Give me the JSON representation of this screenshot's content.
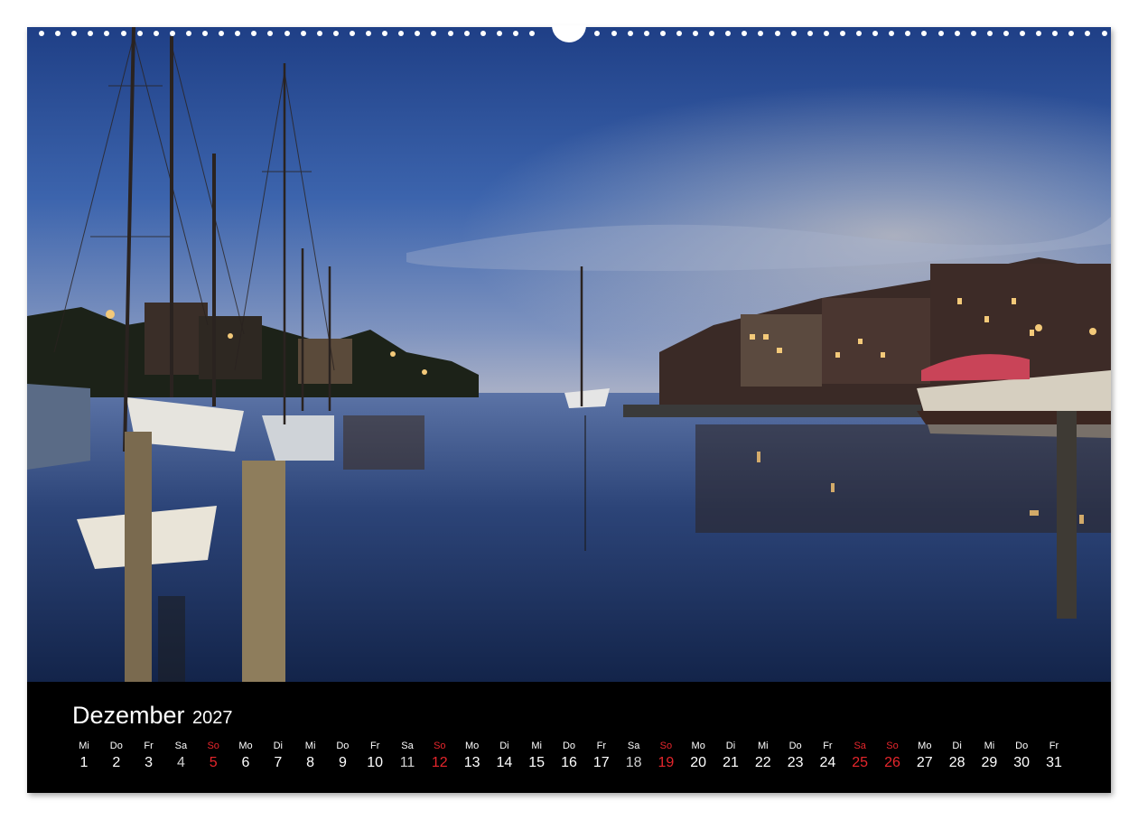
{
  "calendar": {
    "month": "Dezember",
    "year": "2027",
    "colors": {
      "weekday": "#ffffff",
      "sunday": "#e6262c",
      "saturday_number": "#cfcfcf",
      "background": "#000000"
    },
    "days": [
      {
        "wd": "Mi",
        "n": "1",
        "type": "wd"
      },
      {
        "wd": "Do",
        "n": "2",
        "type": "wd"
      },
      {
        "wd": "Fr",
        "n": "3",
        "type": "wd"
      },
      {
        "wd": "Sa",
        "n": "4",
        "type": "sat"
      },
      {
        "wd": "So",
        "n": "5",
        "type": "sun"
      },
      {
        "wd": "Mo",
        "n": "6",
        "type": "wd"
      },
      {
        "wd": "Di",
        "n": "7",
        "type": "wd"
      },
      {
        "wd": "Mi",
        "n": "8",
        "type": "wd"
      },
      {
        "wd": "Do",
        "n": "9",
        "type": "wd"
      },
      {
        "wd": "Fr",
        "n": "10",
        "type": "wd"
      },
      {
        "wd": "Sa",
        "n": "11",
        "type": "sat"
      },
      {
        "wd": "So",
        "n": "12",
        "type": "sun"
      },
      {
        "wd": "Mo",
        "n": "13",
        "type": "wd"
      },
      {
        "wd": "Di",
        "n": "14",
        "type": "wd"
      },
      {
        "wd": "Mi",
        "n": "15",
        "type": "wd"
      },
      {
        "wd": "Do",
        "n": "16",
        "type": "wd"
      },
      {
        "wd": "Fr",
        "n": "17",
        "type": "wd"
      },
      {
        "wd": "Sa",
        "n": "18",
        "type": "sat"
      },
      {
        "wd": "So",
        "n": "19",
        "type": "sun"
      },
      {
        "wd": "Mo",
        "n": "20",
        "type": "wd"
      },
      {
        "wd": "Di",
        "n": "21",
        "type": "wd"
      },
      {
        "wd": "Mi",
        "n": "22",
        "type": "wd"
      },
      {
        "wd": "Do",
        "n": "23",
        "type": "wd"
      },
      {
        "wd": "Fr",
        "n": "24",
        "type": "wd"
      },
      {
        "wd": "Sa",
        "n": "25",
        "type": "hol"
      },
      {
        "wd": "So",
        "n": "26",
        "type": "sun"
      },
      {
        "wd": "Mo",
        "n": "27",
        "type": "wd"
      },
      {
        "wd": "Di",
        "n": "28",
        "type": "wd"
      },
      {
        "wd": "Mi",
        "n": "29",
        "type": "wd"
      },
      {
        "wd": "Do",
        "n": "30",
        "type": "wd"
      },
      {
        "wd": "Fr",
        "n": "31",
        "type": "wd"
      }
    ]
  }
}
